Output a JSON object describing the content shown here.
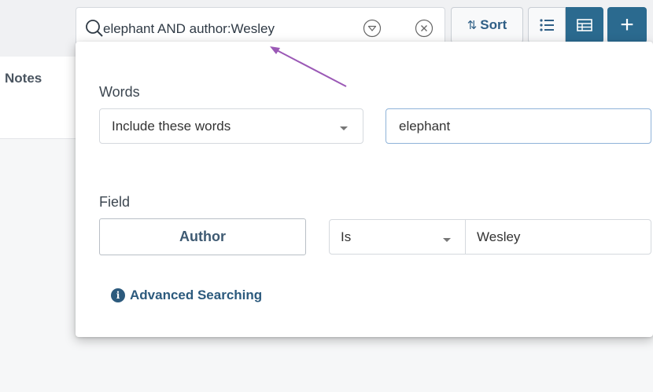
{
  "header": {
    "search": {
      "query": "elephant AND author:Wesley"
    },
    "sort_label": "Sort",
    "add_label": "+"
  },
  "table": {
    "notes_column": "Notes"
  },
  "search_panel": {
    "words": {
      "label": "Words",
      "mode_selected": "Include these words",
      "value": "elephant"
    },
    "field": {
      "label": "Field",
      "field_button": "Author",
      "operator_selected": "Is",
      "value": "Wesley"
    },
    "advanced_link": "Advanced Searching"
  },
  "annotation": {
    "color": "#9b59b6"
  },
  "colors": {
    "accent": "#2b6a8f",
    "link": "#2c5a7d"
  }
}
